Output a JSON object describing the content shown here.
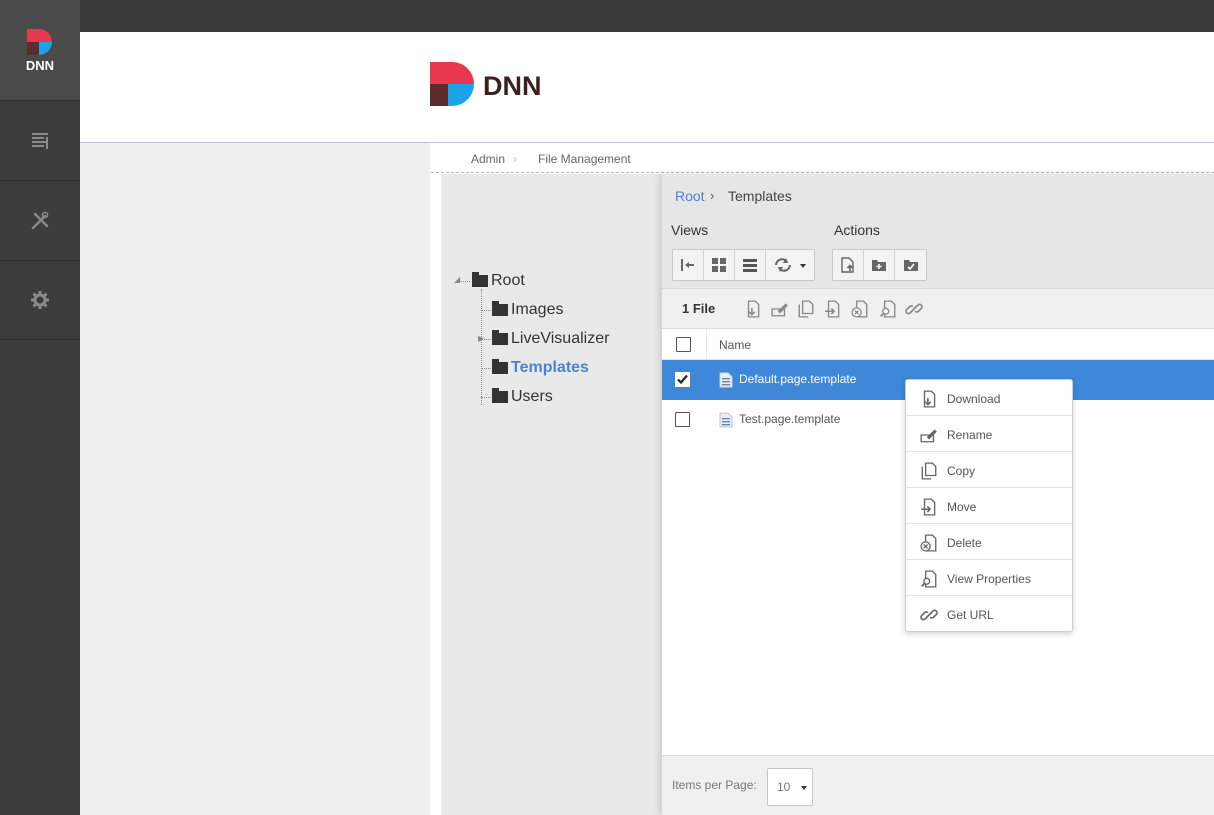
{
  "persona_bar": {
    "logo_text": "DNN",
    "items": [
      {
        "icon": "content-icon"
      },
      {
        "icon": "tools-icon"
      },
      {
        "icon": "settings-icon"
      }
    ]
  },
  "header": {
    "logo_text": "DNN"
  },
  "breadcrumb": {
    "items": [
      "Admin",
      "File Management"
    ]
  },
  "folder_tree": {
    "root": "Root",
    "children": [
      "Images",
      "LiveVisualizer",
      "Templates",
      "Users"
    ],
    "active": "Templates"
  },
  "path": {
    "root": "Root",
    "separator": "›",
    "current": "Templates"
  },
  "toolbar": {
    "views_label": "Views",
    "actions_label": "Actions",
    "view_buttons": [
      "collapse-pane-icon",
      "thumbnail-view-icon",
      "list-view-icon",
      "refresh-icon"
    ],
    "action_buttons": [
      "upload-file-icon",
      "create-folder-icon",
      "sync-folder-icon"
    ]
  },
  "filebar": {
    "count": "1 File",
    "icons": [
      "download-icon",
      "rename-icon",
      "copy-icon",
      "move-icon",
      "delete-icon",
      "view-properties-icon",
      "get-url-icon"
    ]
  },
  "grid": {
    "column_name": "Name",
    "rows": [
      {
        "name": "Default.page.template",
        "checked": true
      },
      {
        "name": "Test.page.template",
        "checked": false
      }
    ]
  },
  "context_menu": {
    "items": [
      {
        "label": "Download",
        "icon": "download-icon"
      },
      {
        "label": "Rename",
        "icon": "rename-icon"
      },
      {
        "label": "Copy",
        "icon": "copy-icon"
      },
      {
        "label": "Move",
        "icon": "move-icon"
      },
      {
        "label": "Delete",
        "icon": "delete-icon"
      },
      {
        "label": "View Properties",
        "icon": "view-properties-icon"
      },
      {
        "label": "Get URL",
        "icon": "get-url-icon"
      }
    ]
  },
  "pager": {
    "label": "Items per Page:",
    "value": "10"
  },
  "colors": {
    "accent": "#3f87d9",
    "link": "#4a84cf",
    "logo_red": "#e8384f",
    "logo_blue": "#1aa3e8",
    "logo_dark": "#5c2b2b",
    "sidebar": "#3d3d3d"
  }
}
